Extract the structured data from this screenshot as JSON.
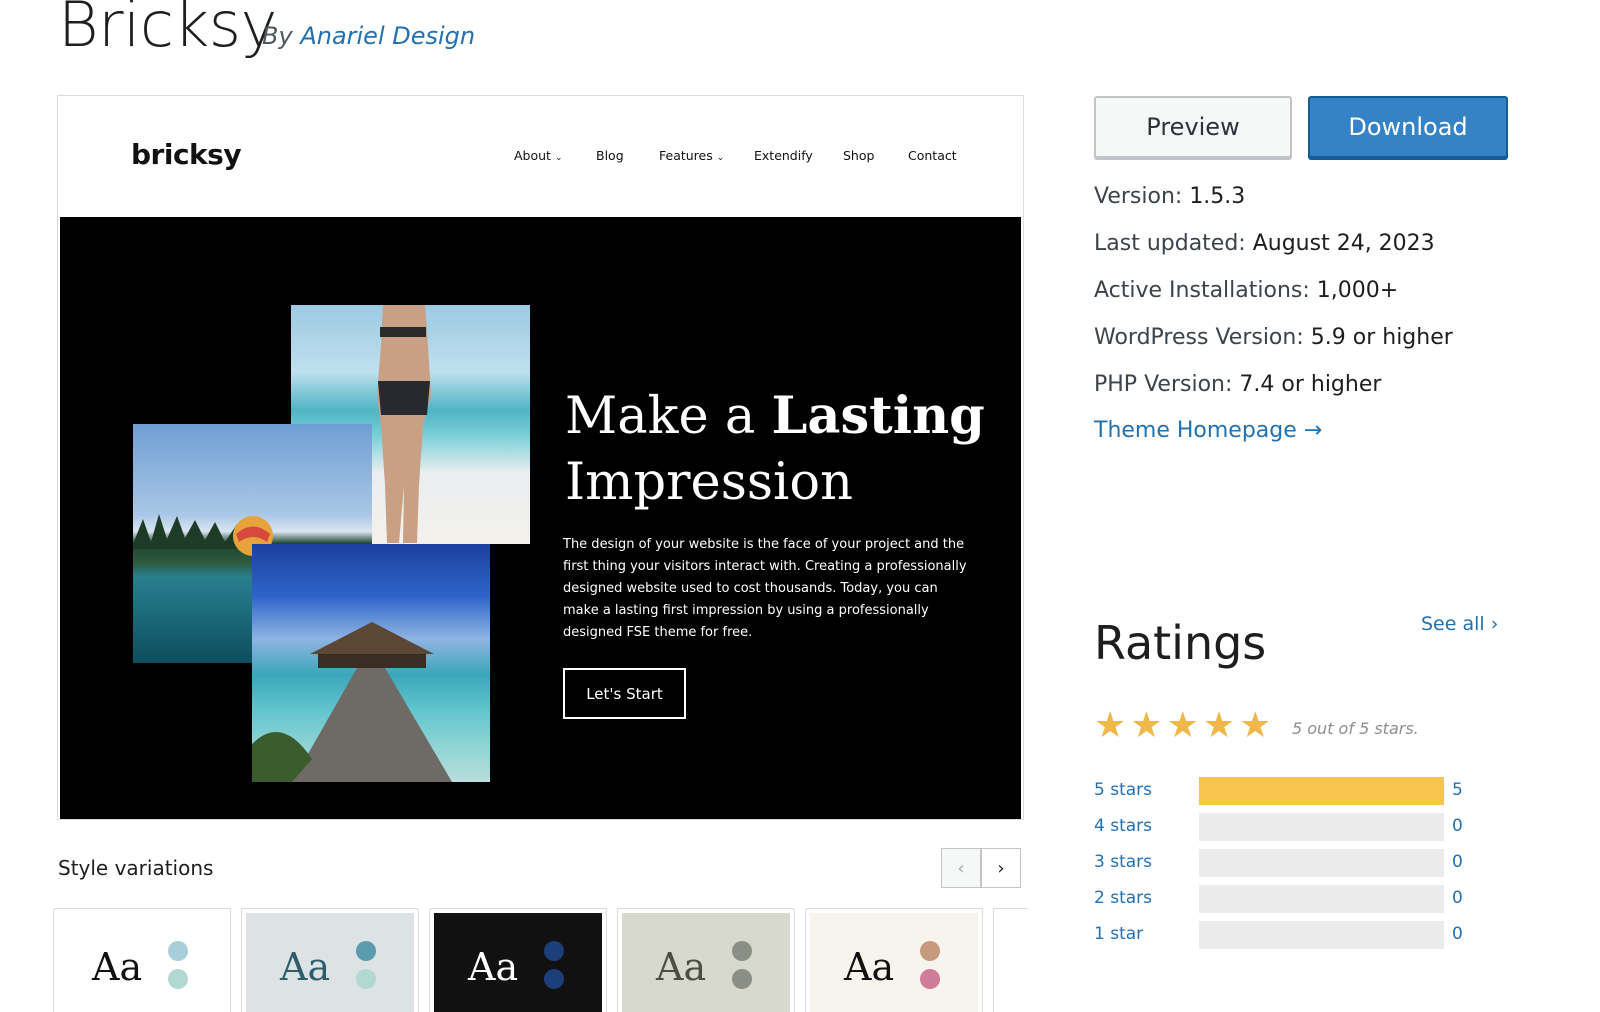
{
  "header": {
    "title": "Bricksy",
    "by_label": "By",
    "author": "Anariel Design"
  },
  "screenshot": {
    "logo": "bricksy",
    "menu": [
      {
        "label": "About",
        "dropdown": true
      },
      {
        "label": "Blog",
        "dropdown": false
      },
      {
        "label": "Features",
        "dropdown": true
      },
      {
        "label": "Extendify",
        "dropdown": false
      },
      {
        "label": "Shop",
        "dropdown": false
      },
      {
        "label": "Contact",
        "dropdown": false
      }
    ],
    "heading_regular_1": "Make a ",
    "heading_bold": "Lasting",
    "heading_regular_2": "Impression",
    "body": "The design of your website is the face of your project and the first thing your visitors interact with. Creating a professionally designed website used to cost thousands. Today, you can make a lasting first impression by using a professionally designed FSE theme for free.",
    "cta": "Let's Start"
  },
  "style_variations": {
    "title": "Style variations",
    "sample_text": "Aa",
    "cards": [
      {
        "bg": "#ffffff",
        "text": "#111111",
        "dot1": "#a8cfd9",
        "dot2": "#b2d8d4"
      },
      {
        "bg": "#dde2e5",
        "text": "#2c5f6b",
        "dot1": "#5a9bb0",
        "dot2": "#b2d8d4"
      },
      {
        "bg": "#111111",
        "text": "#ffffff",
        "dot1": "#1c3f7a",
        "dot2": "#1c3f7a"
      },
      {
        "bg": "#d7d9cf",
        "text": "#4a4e45",
        "dot1": "#8a8e84",
        "dot2": "#8a8e84"
      },
      {
        "bg": "#f7f4ee",
        "text": "#111111",
        "dot1": "#c79a80",
        "dot2": "#cf7c9a"
      }
    ]
  },
  "actions": {
    "preview": "Preview",
    "download": "Download"
  },
  "meta": {
    "version_label": "Version:",
    "version": "1.5.3",
    "updated_label": "Last updated:",
    "updated": "August 24, 2023",
    "installs_label": "Active Installations:",
    "installs": "1,000+",
    "wp_label": "WordPress Version:",
    "wp": "5.9 or higher",
    "php_label": "PHP Version:",
    "php": "7.4 or higher",
    "homepage": "Theme Homepage →"
  },
  "ratings": {
    "title": "Ratings",
    "see_all": "See all",
    "stars_text": "5 out of 5 stars.",
    "rows": [
      {
        "label": "5 stars",
        "count": "5",
        "fraction": 1.0
      },
      {
        "label": "4 stars",
        "count": "0",
        "fraction": 0
      },
      {
        "label": "3 stars",
        "count": "0",
        "fraction": 0
      },
      {
        "label": "2 stars",
        "count": "0",
        "fraction": 0
      },
      {
        "label": "1 star",
        "count": "0",
        "fraction": 0
      }
    ]
  },
  "colors": {
    "link": "#2271b1",
    "primary_button": "#3582c4",
    "star": "#f0b849",
    "bar_fill": "#f7c54b"
  }
}
